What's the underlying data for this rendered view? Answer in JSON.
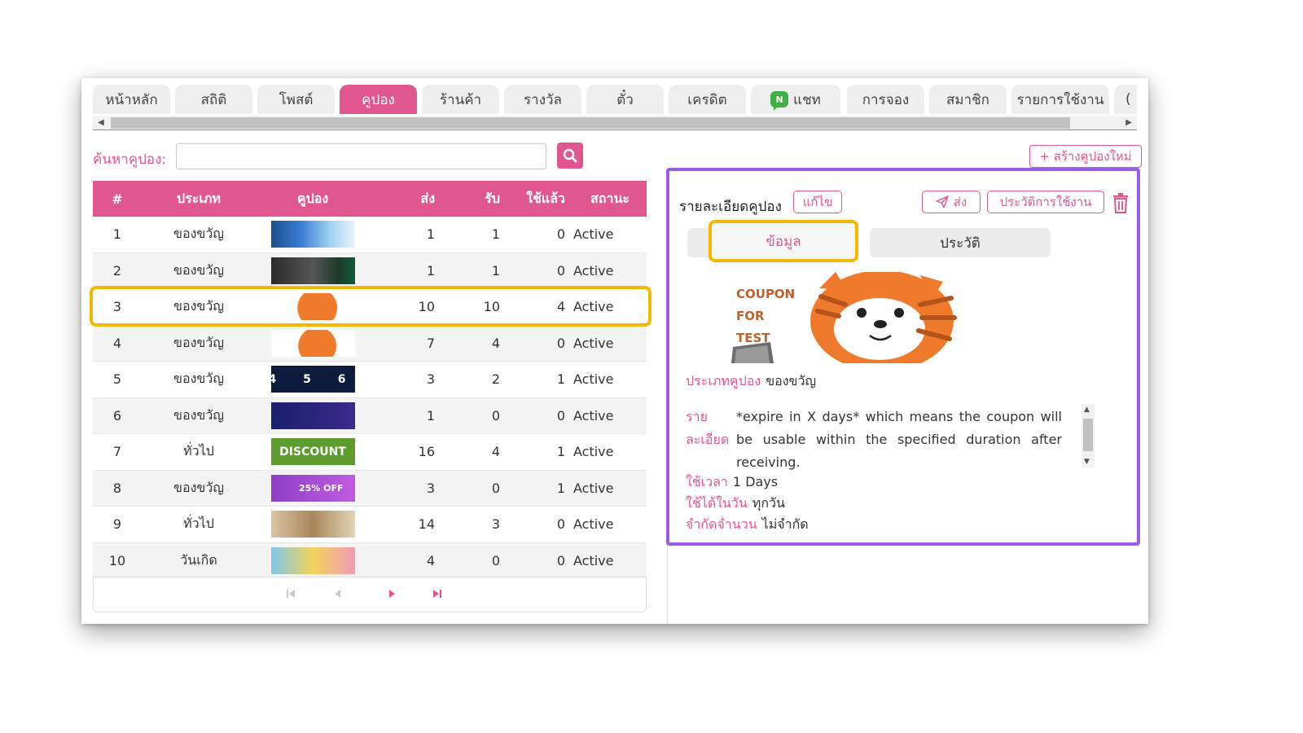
{
  "tabs": [
    {
      "label": "หน้าหลัก",
      "active": false
    },
    {
      "label": "สถิติ",
      "active": false
    },
    {
      "label": "โพสต์",
      "active": false
    },
    {
      "label": "คูปอง",
      "active": true
    },
    {
      "label": "ร้านค้า",
      "active": false
    },
    {
      "label": "รางวัล",
      "active": false
    },
    {
      "label": "ตั๋ว",
      "active": false
    },
    {
      "label": "เครดิต",
      "active": false
    },
    {
      "label": "แชท",
      "active": false,
      "icon": "chat-icon"
    },
    {
      "label": "การจอง",
      "active": false
    },
    {
      "label": "สมาชิก",
      "active": false
    },
    {
      "label": "รายการใช้งาน",
      "active": false
    },
    {
      "label": "(",
      "active": false
    }
  ],
  "search": {
    "label": "ค้นหาคูปอง:",
    "value": "",
    "placeholder": ""
  },
  "create_button": "+ สร้างคูปองใหม่",
  "table": {
    "headers": {
      "no": "#",
      "type": "ประเภท",
      "coupon": "คูปอง",
      "send": "ส่ง",
      "recv": "รับ",
      "used": "ใช้แล้ว",
      "status": "สถานะ"
    },
    "rows": [
      {
        "no": "1",
        "type": "ของขวัญ",
        "send": "1",
        "recv": "1",
        "used": "0",
        "status": "Active",
        "thumb": ""
      },
      {
        "no": "2",
        "type": "ของขวัญ",
        "send": "1",
        "recv": "1",
        "used": "0",
        "status": "Active",
        "thumb": ""
      },
      {
        "no": "3",
        "type": "ของขวัญ",
        "send": "10",
        "recv": "10",
        "used": "4",
        "status": "Active",
        "thumb": ""
      },
      {
        "no": "4",
        "type": "ของขวัญ",
        "send": "7",
        "recv": "4",
        "used": "0",
        "status": "Active",
        "thumb": ""
      },
      {
        "no": "5",
        "type": "ของขวัญ",
        "send": "3",
        "recv": "2",
        "used": "1",
        "status": "Active",
        "thumb": "4 5 6"
      },
      {
        "no": "6",
        "type": "ของขวัญ",
        "send": "1",
        "recv": "0",
        "used": "0",
        "status": "Active",
        "thumb": ""
      },
      {
        "no": "7",
        "type": "ทั่วไป",
        "send": "16",
        "recv": "4",
        "used": "1",
        "status": "Active",
        "thumb": "DISCOUNT"
      },
      {
        "no": "8",
        "type": "ของขวัญ",
        "send": "3",
        "recv": "0",
        "used": "1",
        "status": "Active",
        "thumb": "25% OFF"
      },
      {
        "no": "9",
        "type": "ทั่วไป",
        "send": "14",
        "recv": "3",
        "used": "0",
        "status": "Active",
        "thumb": ""
      },
      {
        "no": "10",
        "type": "วันเกิด",
        "send": "4",
        "recv": "0",
        "used": "0",
        "status": "Active",
        "thumb": ""
      }
    ]
  },
  "detail": {
    "title": "รายละเอียดคูปอง",
    "edit_button": "แก้ไข",
    "send_button": "ส่ง",
    "history_button": "ประวัติการใช้งาน",
    "tab_info": "ข้อมูล",
    "tab_history": "ประวัติ",
    "coupon_image_text": [
      "COUPON",
      "FOR",
      "TEST"
    ],
    "type_label": "ประเภทคูปอง",
    "type_value": "ของขวัญ",
    "desc_label_1": "ราย",
    "desc_label_2": "ละเอียด",
    "desc_value": "*expire in X days* which means the coupon will be usable within the specified duration after receiving.",
    "duration_label": "ใช้เวลา",
    "duration_value": "1 Days",
    "days_label": "ใช้ได้ในวัน",
    "days_value": "ทุกวัน",
    "limit_label": "จำกัดจำนวน",
    "limit_value": "ไม่จำกัด"
  },
  "colors": {
    "accent": "#e0578f",
    "highlight": "#f5b800",
    "panel_border": "#9b5de5"
  }
}
